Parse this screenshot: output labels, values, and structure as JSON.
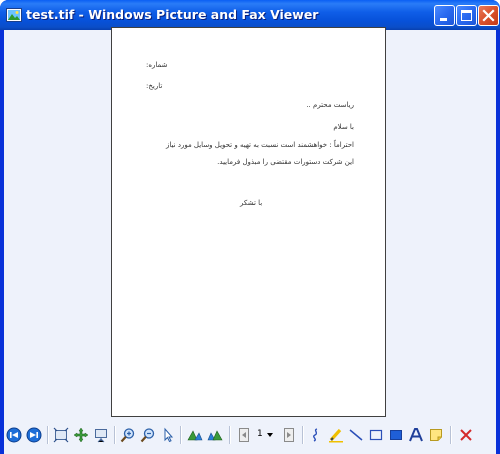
{
  "window": {
    "title": "test.tif - Windows Picture and Fax Viewer"
  },
  "document": {
    "lines": [
      "شماره:",
      "تاریخ:",
      "ریاست محترم ..",
      "با سلام",
      "احتراماً : خواهشمند است نسبت به تهیه و تحویل وسایل مورد نیاز",
      "این شرکت دستورات مقتضی را مبذول فرمایید.",
      "با تشکر"
    ]
  },
  "toolbar": {
    "page_number": "1",
    "icons": [
      "previous-image-icon",
      "next-image-icon",
      "best-fit-icon",
      "actual-size-icon",
      "slideshow-icon",
      "zoom-in-icon",
      "zoom-out-icon",
      "select-pointer-icon",
      "rotate-clockwise-icon",
      "rotate-counterclockwise-icon",
      "previous-page-icon",
      "page-dropdown-icon",
      "next-page-icon",
      "freehand-annotation-icon",
      "highlighter-icon",
      "line-icon",
      "hollow-rectangle-icon",
      "filled-rectangle-icon",
      "text-annotation-icon",
      "sticky-note-icon",
      "delete-icon"
    ]
  },
  "colors": {
    "titlebar": "#0a5ff4",
    "client_background": "#eef2fb",
    "close_button": "#d9522c"
  }
}
